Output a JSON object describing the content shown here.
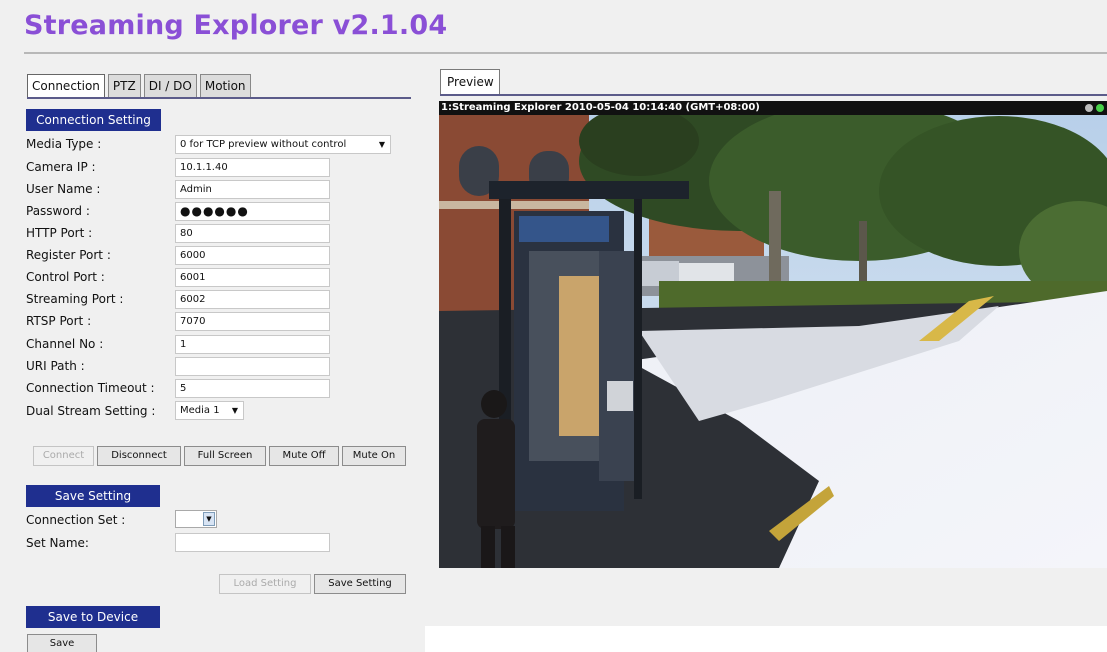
{
  "app": {
    "title": "Streaming Explorer v2.1.04"
  },
  "tabs": [
    {
      "label": "Connection",
      "active": true
    },
    {
      "label": "PTZ",
      "active": false
    },
    {
      "label": "DI / DO",
      "active": false
    },
    {
      "label": "Motion",
      "active": false
    }
  ],
  "connection_setting": {
    "header": "Connection Setting",
    "media_type": {
      "label": "Media Type :",
      "value": "0 for TCP preview without control"
    },
    "camera_ip": {
      "label": "Camera IP :",
      "value": "10.1.1.40"
    },
    "user_name": {
      "label": "User Name :",
      "value": "Admin"
    },
    "password": {
      "label": "Password :",
      "value": "●●●●●●"
    },
    "http_port": {
      "label": "HTTP Port :",
      "value": "80"
    },
    "register_port": {
      "label": "Register Port :",
      "value": "6000"
    },
    "control_port": {
      "label": "Control Port :",
      "value": "6001"
    },
    "streaming_port": {
      "label": "Streaming Port :",
      "value": "6002"
    },
    "rtsp_port": {
      "label": "RTSP Port :",
      "value": "7070"
    },
    "channel_no": {
      "label": "Channel No :",
      "value": "1"
    },
    "uri_path": {
      "label": "URI Path :",
      "value": ""
    },
    "connection_timeout": {
      "label": "Connection Timeout :",
      "value": "5"
    },
    "dual_stream": {
      "label": "Dual Stream Setting :",
      "value": "Media 1"
    }
  },
  "actions": {
    "connect": "Connect",
    "disconnect": "Disconnect",
    "full_screen": "Full Screen",
    "mute_off": "Mute Off",
    "mute_on": "Mute On"
  },
  "save_setting": {
    "header": "Save Setting",
    "connection_set_label": "Connection Set :",
    "connection_set_value": "",
    "set_name_label": "Set Name:",
    "set_name_value": "",
    "load_button": "Load Setting",
    "save_button": "Save Setting"
  },
  "save_device": {
    "header": "Save to Device",
    "save_button": "Save"
  },
  "preview": {
    "tab_label": "Preview",
    "overlay_text": "1:Streaming Explorer   2010-05-04 10:14:40 (GMT+08:00)"
  },
  "colors": {
    "title": "#8a4fd6",
    "header_bg": "#1f2f8f"
  }
}
